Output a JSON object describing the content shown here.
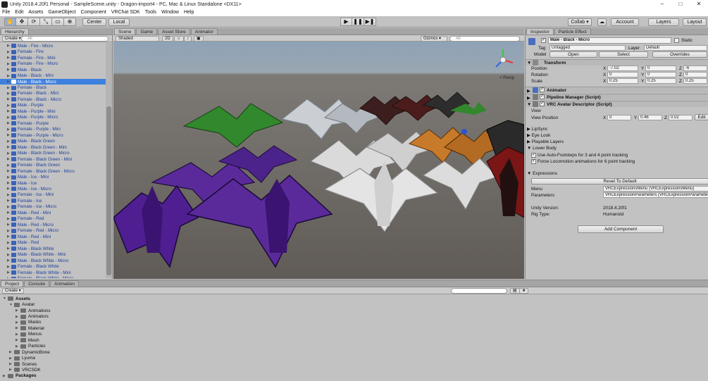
{
  "window": {
    "title": "Unity 2018.4.20f1 Personal - SampleScene.unity - Dragon-import4 - PC, Mac & Linux Standalone <DX11>",
    "controls": [
      "–",
      "□",
      "✕"
    ]
  },
  "menu": [
    "File",
    "Edit",
    "Assets",
    "GameObject",
    "Component",
    "VRChat SDK",
    "Tools",
    "Window",
    "Help"
  ],
  "toolbar": {
    "tools": [
      "✋",
      "✥",
      "⟳",
      "⤡",
      "▭",
      "⊕"
    ],
    "pivot": "Center",
    "space": "Local",
    "play_buttons": [
      "▶",
      "❚❚",
      "▶❚"
    ],
    "collab": "Collab ▾",
    "account": "Account",
    "layers": "Layers",
    "layout": "Layout"
  },
  "hierarchy": {
    "tab": "Hierarchy",
    "create": "Create ▾",
    "search_placeholder": "All",
    "selected_index": 6,
    "items": [
      "Male - Fire - Micro",
      "Female - Fire",
      "Female - Fire - Mini",
      "Female - Fire - Micro",
      "Male - Black",
      "Male - Black - Mini",
      "Male - Black - Micro",
      "Female - Black",
      "Female - Black - Mini",
      "Female - Black - Micro",
      "Male - Purple",
      "Male - Purple - Mini",
      "Male - Purple - Micro",
      "Female - Purple",
      "Female - Purple - Mini",
      "Female - Purple - Micro",
      "Male - Black Green",
      "Male - Black Green - Mini",
      "Male - Black Green - Micro",
      "Female - Black Green - Mini",
      "Female - Black Green",
      "Female - Black Green - Micro",
      "Male - Ice - Mini",
      "Male - Ice",
      "Male - Ice - Micro",
      "Female - Ice - Mini",
      "Female - Ice",
      "Female - Ice - Micro",
      "Male - Red - Mini",
      "Female - Red",
      "Male - Red - Micro",
      "Female - Red - Micro",
      "Male - Red - Mini",
      "Male - Red",
      "Male - Black White",
      "Male - Black White - Mini",
      "Male - Black White - Micro",
      "Female - Black White",
      "Female - Black White - Mini",
      "Female - Black White - Micro"
    ]
  },
  "scene": {
    "tabs": [
      "Scene",
      "Game",
      "Asset Store",
      "Animator"
    ],
    "shading": "Shaded",
    "mode_2d": "2D",
    "gizmos": "Gizmos ▾",
    "search_placeholder": "All",
    "persp": "< Persp"
  },
  "inspector": {
    "tabs": [
      "Inspector",
      "Particle Effect"
    ],
    "object_name": "Male - Black - Micro",
    "static_label": "Static",
    "tag_label": "Tag",
    "tag_value": "Untagged",
    "layer_label": "Layer",
    "layer_value": "Default",
    "model_label": "Model",
    "model_open": "Open",
    "model_select": "Select",
    "model_overrides": "Overrides",
    "transform": {
      "title": "Transform",
      "position_label": "Position",
      "rotation_label": "Rotation",
      "scale_label": "Scale",
      "position": [
        "-7.02",
        "0",
        "-6"
      ],
      "rotation": [
        "0",
        "0",
        "0"
      ],
      "scale": [
        "0.25",
        "0.25",
        "0.25"
      ]
    },
    "components": [
      "Animator",
      "Pipeline Manager (Script)",
      "VRC Avatar Descriptor (Script)"
    ],
    "view_label": "View",
    "view_position_label": "View Position",
    "view_position": [
      "0",
      "0.46",
      "0.02"
    ],
    "edit_label": "Edit",
    "foldouts": [
      "LipSync",
      "Eye Look",
      "Playable Layers",
      "Lower Body"
    ],
    "auto_footsteps": "Use Auto-Footsteps for 3 and 4 point tracking",
    "force_locomotion": "Force Locomotion animations for 6 point tracking",
    "expressions_label": "Expressions",
    "reset_default": "Reset To Default",
    "menu_label": "Menu",
    "menu_value": "VRCExpressionsMenu (VRCExpressionsMenu)",
    "params_label": "Parameters",
    "params_value": "VRCExpressionParameters (VRCExpressionParameters)",
    "unity_version_label": "Unity Version:",
    "unity_version": "2018.4.20f1",
    "rig_type_label": "Rig Type:",
    "rig_type": "Humanoid",
    "add_component": "Add Component"
  },
  "project": {
    "tabs": [
      "Project",
      "Console",
      "Animation"
    ],
    "create": "Create ▾",
    "tree": [
      {
        "label": "Assets",
        "depth": 0,
        "open": true,
        "bold": true
      },
      {
        "label": "Avatar",
        "depth": 1,
        "open": true
      },
      {
        "label": "Animations",
        "depth": 2
      },
      {
        "label": "Animators",
        "depth": 2
      },
      {
        "label": "Masks",
        "depth": 2
      },
      {
        "label": "Material",
        "depth": 2
      },
      {
        "label": "Menus",
        "depth": 2
      },
      {
        "label": "Mesh",
        "depth": 2
      },
      {
        "label": "Particles",
        "depth": 2
      },
      {
        "label": "DynamicBone",
        "depth": 1
      },
      {
        "label": "Lyuma",
        "depth": 1
      },
      {
        "label": "Scenes",
        "depth": 1
      },
      {
        "label": "VRCSDK",
        "depth": 1
      },
      {
        "label": "Packages",
        "depth": 0,
        "bold": true
      }
    ]
  },
  "colors": {
    "selection": "#3d80df",
    "hierarchy_text": "#1e3f9c",
    "dragon_green": "#2f8a2a",
    "dragon_purple": "#5a2a9a",
    "dragon_white": "#d8d8d8",
    "dragon_orange": "#c77a2a",
    "dragon_black": "#2a2a2a",
    "dragon_red": "#8a1a1a"
  }
}
